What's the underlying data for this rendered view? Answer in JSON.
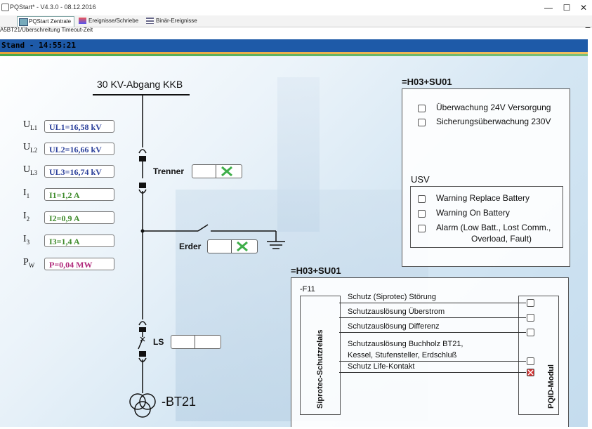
{
  "window": {
    "title": "PQStart* - V4.3.0 - 08.12.2016"
  },
  "tabs": [
    {
      "label": "PQStart Zentrale",
      "active": true
    },
    {
      "label": "Ereignisse/Schriebe",
      "active": false
    },
    {
      "label": "Binär-Ereignisse",
      "active": false
    }
  ],
  "breadcrumb": "A5BT21/Überschreitung Timeout-Zeit",
  "status": {
    "text": "Stand - 14:55:21"
  },
  "diagram": {
    "feeder_title": "30 KV-Abgang KKB",
    "transformer_label": "-BT21",
    "switches": {
      "trenner": "Trenner",
      "erder": "Erder",
      "ls": "LS"
    }
  },
  "measurements": [
    {
      "symbol": "U",
      "sub": "L1",
      "value": "UL1=16,58 kV",
      "color": "#2a3f9a"
    },
    {
      "symbol": "U",
      "sub": "L2",
      "value": "UL2=16,66 kV",
      "color": "#2a3f9a"
    },
    {
      "symbol": "U",
      "sub": "L3",
      "value": "UL3=16,74 kV",
      "color": "#2a3f9a"
    },
    {
      "symbol": "I",
      "sub": "1",
      "value": "I1=1,2 A",
      "color": "#3d8a2a"
    },
    {
      "symbol": "I",
      "sub": "2",
      "value": "I2=0,9 A",
      "color": "#3d8a2a"
    },
    {
      "symbol": "I",
      "sub": "3",
      "value": "I3=1,4 A",
      "color": "#3d8a2a"
    },
    {
      "symbol": "P",
      "sub": "W",
      "value": "P=0,04 MW",
      "color": "#b0287a"
    }
  ],
  "panel_top": {
    "title": "=H03+SU01",
    "items": [
      "Überwachung 24V Versorgung",
      "Sicherungsüberwachung 230V"
    ],
    "usv": {
      "title": "USV",
      "items": [
        "Warning Replace Battery",
        "Warning On Battery"
      ],
      "alarm_line1": "Alarm (Low Batt., Lost Comm.,",
      "alarm_line2": "Overload, Fault)"
    }
  },
  "panel_bottom": {
    "title": "=H03+SU01",
    "sub": "-F11",
    "relay_label": "Siprotec-Schutzrelais",
    "module_label": "PQID-Modul",
    "signals": [
      {
        "label": "Schutz (Siprotec) Störung",
        "alarm": false
      },
      {
        "label": "Schutzauslösung Überstrom",
        "alarm": false
      },
      {
        "label": "Schutzauslösung Differenz",
        "alarm": false
      },
      {
        "label": "Schutzauslösung Buchholz BT21,",
        "label2": "Kessel, Stufensteller, Erdschluß",
        "alarm": false
      },
      {
        "label": "Schutz Life-Kontakt",
        "alarm": true
      }
    ]
  },
  "colors": {
    "statusbar": "#1e5aa8",
    "ok_cross": "#3fae4a",
    "alarm": "#d83030"
  }
}
